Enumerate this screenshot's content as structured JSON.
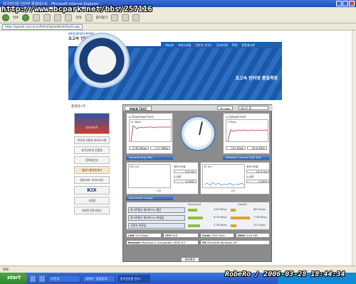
{
  "watermark_url": "http://www.bcpark.net/bbs/257116",
  "watermark_sign": "RobeRo / 2006-03-28 18:44:34",
  "window": {
    "title": "한국전산원 인터넷 품질테스트 - Microsoft Internet Explorer"
  },
  "menu": [
    "파일(F)",
    "편집(E)",
    "보기(V)",
    "즐겨찾기(A)",
    "도구(T)",
    "도움말(H)"
  ],
  "toolbar": {
    "back": "뒤로",
    "search": "검색",
    "favorites": "즐겨찾기"
  },
  "address": {
    "label": "주소(D)",
    "url": "http://speed.nca.or.kr/html/speedtest/fault.asp"
  },
  "banner": {
    "logo_small": "WEB BENCHMARK",
    "logo_title": "초고속 인터넷 속도테스트",
    "nav": [
      "About",
      "서비스흐름",
      "인터넷 가이드",
      "공지/사례",
      "FAQ",
      "품질게시판"
    ],
    "headline": "초고속 인터넷 품질측정"
  },
  "left": {
    "header": "품질테스트",
    "buttons": [
      "속도테스트",
      "인터넷 사용자 보호시스템",
      "한국인터넷 진흥원",
      "정보통신부",
      "불법스팸대응센터",
      "정보보호 가이드라인",
      "KIX",
      "국정원",
      "대한민국전자정부"
    ]
  },
  "panel": {
    "tab": "MAIN TEST",
    "upgrade": "To upgr",
    "select": "테스트 중",
    "download": {
      "title": "Download test",
      "mbps": "5.38 Mbps",
      "mbytes": "1.17 MB/s",
      "axis_top": "15 Mbps",
      "link": "General Ping Test"
    },
    "upload": {
      "title": "Upload test",
      "mbps": "741 Kbps",
      "mbytes": "92.6 KB/s",
      "axis_top": "1 Mbps",
      "link": "Network Camera VoIP Test"
    },
    "ping": {
      "min_label": "왕복지연율",
      "min": "0.0 ms",
      "loss_label": "손실률",
      "loss": "0.00%",
      "axis": "300 ms",
      "time": "시간"
    },
    "voip": {
      "min_label": "왕복지연율",
      "min": "15.4 ms",
      "loss_label": "손실률",
      "loss": "0.00%",
      "axis": "50 ms",
      "time": "시간"
    },
    "bandwidth_link": "Bandwidth Gauge",
    "compare_header_down": "Download",
    "compare_header_up": "Upload",
    "compare_rows": [
      {
        "name": "하나로통신 제3계 Pro 평균",
        "down": "4.63 Mbps",
        "up": "680 Kbps",
        "down_frac": 0.22,
        "up_frac": 0.12
      },
      {
        "name": "하나로통신 제3계 Pro 최대값",
        "down": "6.00 Mbps",
        "up": "7.98 Mbps",
        "down_frac": 0.35,
        "up_frac": 0.45
      },
      {
        "name": "사용자 측정값",
        "down": "5.38 Mbps",
        "up": "741 Kbps",
        "down_frac": 0.28,
        "up_frac": 0.13
      }
    ],
    "specs": {
      "lan_label": "LAN",
      "lan": "100 Mbps",
      "cpu_label": "CPU",
      "cpu": "556",
      "clock_label": "Clock",
      "clock": "2992 MHz",
      "ram_label": "RAM",
      "ram": "1024 MB",
      "browser_label": "Browser",
      "browser": "Mozilla/4.0 compatible; MSIE 6.0",
      "os_label": "OS",
      "os": "Microsoft Windows XP"
    },
    "result_button": "결과확인"
  },
  "statusbar": {
    "text": "완료"
  },
  "taskbar": {
    "start": "start",
    "tasks": [
      "내 문서",
      "네이버 - 통합검색...",
      "한국전산원 인터..."
    ]
  }
}
